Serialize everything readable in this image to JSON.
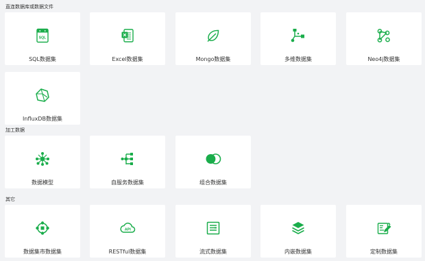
{
  "accent_color": "#1aad4b",
  "sections": [
    {
      "title": "直连数据库或数据文件",
      "cards": [
        {
          "label": "SQL数据集",
          "icon": "sql-file-icon"
        },
        {
          "label": "Excel数据集",
          "icon": "excel-file-icon"
        },
        {
          "label": "Mongo数据集",
          "icon": "mongo-leaf-icon"
        },
        {
          "label": "多维数据集",
          "icon": "cube-axes-icon"
        },
        {
          "label": "Neo4j数据集",
          "icon": "graph-nodes-icon"
        },
        {
          "label": "InfluxDB数据集",
          "icon": "influx-polyhedron-icon"
        }
      ]
    },
    {
      "title": "加工数据",
      "cards": [
        {
          "label": "数据模型",
          "icon": "data-model-network-icon"
        },
        {
          "label": "自服务数据集",
          "icon": "self-service-flow-icon"
        },
        {
          "label": "组合数据集",
          "icon": "combine-circles-icon"
        }
      ]
    },
    {
      "title": "其它",
      "cards": [
        {
          "label": "数据集市数据集",
          "icon": "data-mart-icon"
        },
        {
          "label": "RESTful数据集",
          "icon": "api-cloud-icon"
        },
        {
          "label": "流式数据集",
          "icon": "stream-document-icon"
        },
        {
          "label": "内嵌数据集",
          "icon": "layers-stack-icon"
        },
        {
          "label": "定制数据集",
          "icon": "custom-edit-icon"
        }
      ]
    }
  ]
}
